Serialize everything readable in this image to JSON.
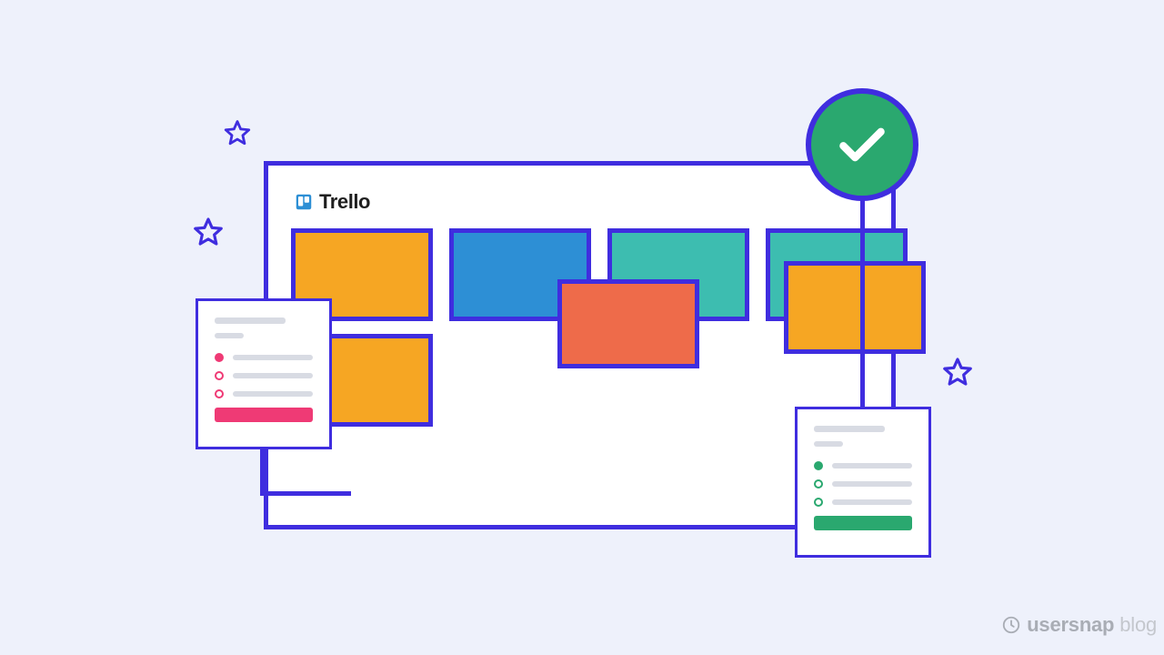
{
  "brand": {
    "name": "Trello"
  },
  "watermark": {
    "strong": "usersnap",
    "light": "blog"
  },
  "colors": {
    "border": "#3f2ddf",
    "orange": "#f6a623",
    "blue": "#2d8fd5",
    "teal": "#3dbdb0",
    "coral": "#ee6b4a",
    "green": "#2aa86f",
    "pink": "#ef3a75"
  },
  "notes": {
    "left": {
      "accent": "pink"
    },
    "right": {
      "accent": "green"
    }
  }
}
